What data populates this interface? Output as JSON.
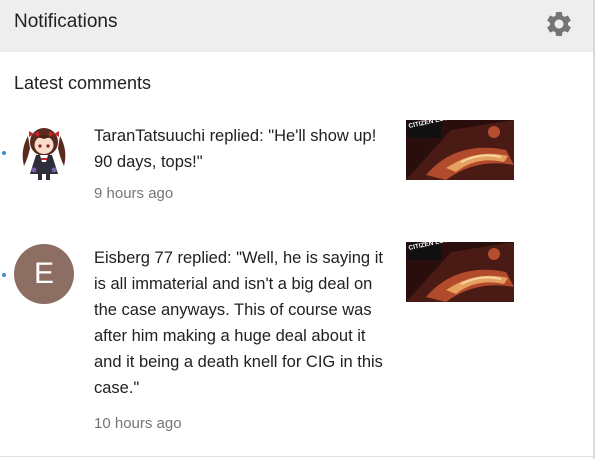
{
  "header": {
    "title": "Notifications",
    "settings_icon": "gear-icon"
  },
  "section": {
    "title": "Latest comments"
  },
  "notifications": [
    {
      "comment": "TaranTatsuuchi replied: \"He'll show up! 90 days, tops!\"",
      "time": "9 hours ago",
      "avatar": "anime-character-avatar",
      "unread": true,
      "thumbnail_text": "CITIZEN LOST"
    },
    {
      "comment": "Eisberg 77 replied: \"Well, he is saying it is all immaterial and isn't a big deal on the case anyways. This of course was after him making a huge deal about it and it being a death knell for CIG in this case.\"",
      "time": "10 hours ago",
      "avatar_letter": "E",
      "avatar_color": "#8d6e63",
      "unread": true,
      "thumbnail_text": "CITIZEN LOST"
    }
  ],
  "colors": {
    "header_bg": "#eeeeee",
    "unread_dot": "#3d8ecd",
    "secondary_text": "#757575"
  }
}
